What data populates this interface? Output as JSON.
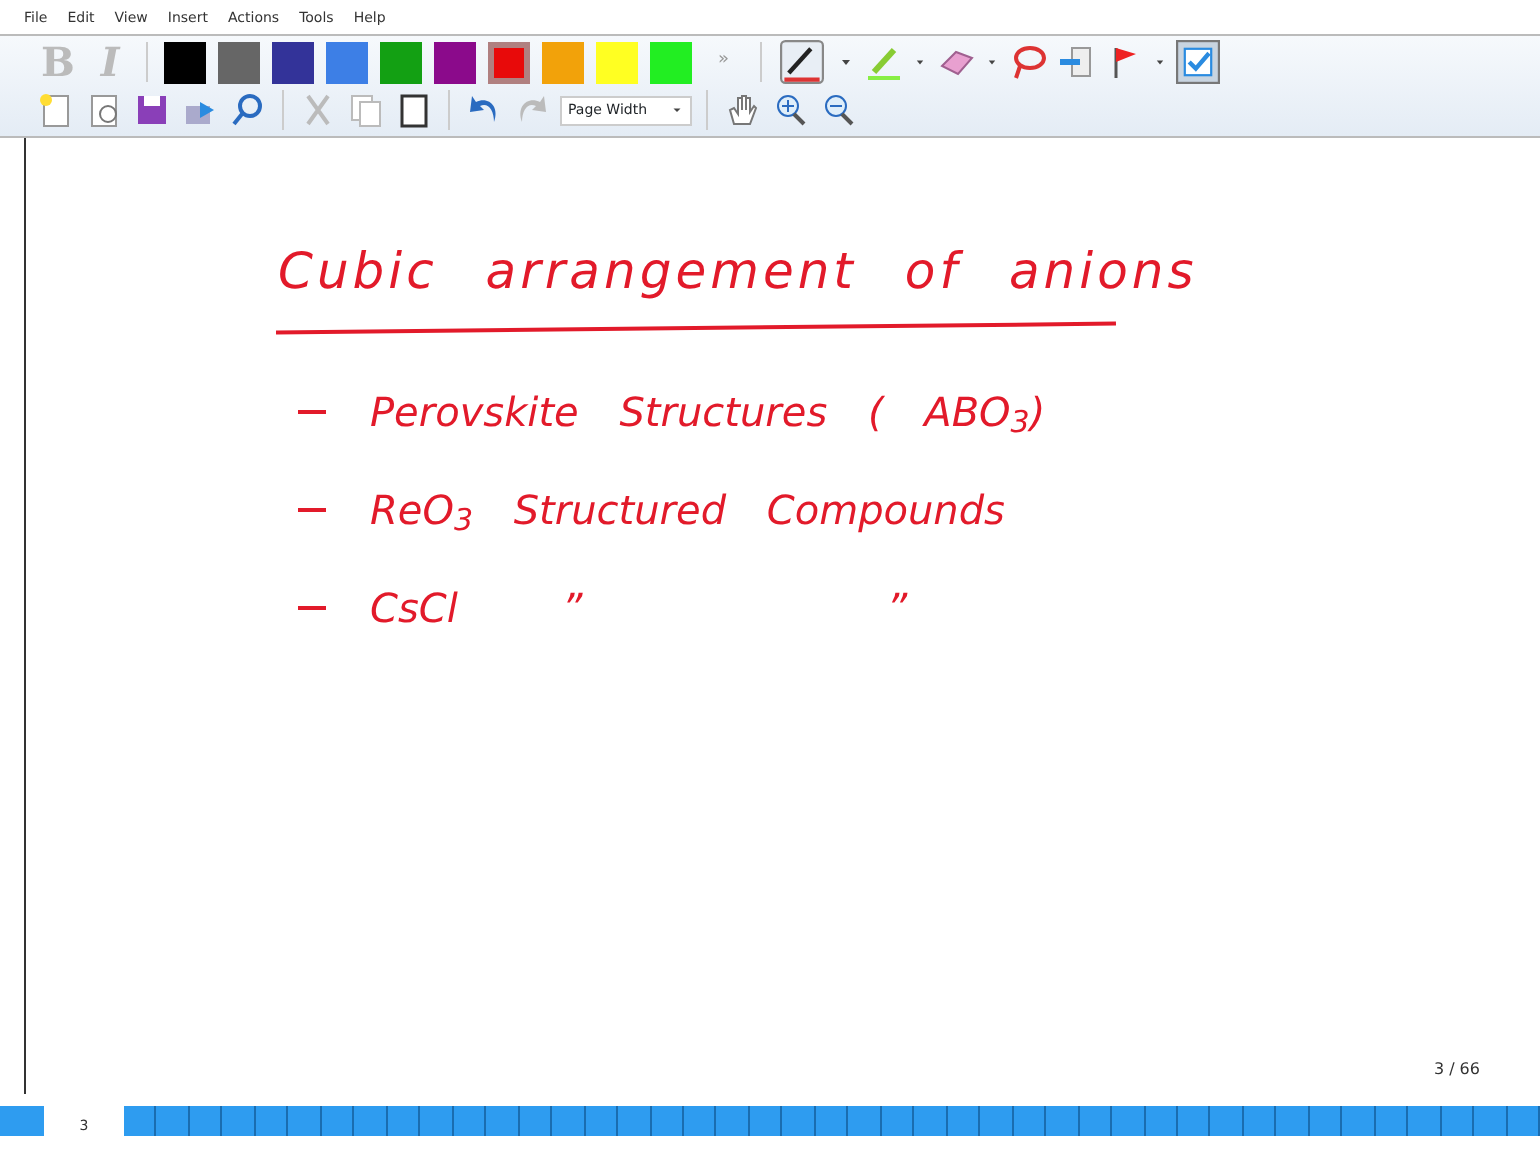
{
  "menu": [
    "File",
    "Edit",
    "View",
    "Insert",
    "Actions",
    "Tools",
    "Help"
  ],
  "format_buttons": [
    {
      "label": "B",
      "kind": "bold"
    },
    {
      "label": "I",
      "kind": "italic"
    }
  ],
  "pen_colors": [
    {
      "color": "#000000",
      "selected": false
    },
    {
      "color": "#666666",
      "selected": false
    },
    {
      "color": "#333399",
      "selected": false
    },
    {
      "color": "#3d7fe6",
      "selected": false
    },
    {
      "color": "#13a013",
      "selected": false
    },
    {
      "color": "#8b0a8b",
      "selected": false
    },
    {
      "color": "#e80a0a",
      "selected": true
    },
    {
      "color": "#f2a20a",
      "selected": false
    },
    {
      "color": "#ffff22",
      "selected": false
    },
    {
      "color": "#22ee22",
      "selected": false
    }
  ],
  "overflow": "»",
  "zoom_dropdown": {
    "value": "Page Width"
  },
  "note": {
    "title": "Cubic arrangement of anions",
    "items": [
      {
        "text": "Perovskite Structures ( ABO$_{3}$)"
      },
      {
        "text": "ReO$_{3}$ Structured Compounds"
      },
      {
        "text": "CsCl",
        "ditto": [
          "”",
          "”"
        ]
      }
    ]
  },
  "page_indicator": "3 / 66",
  "page_strip": {
    "current": "3"
  }
}
